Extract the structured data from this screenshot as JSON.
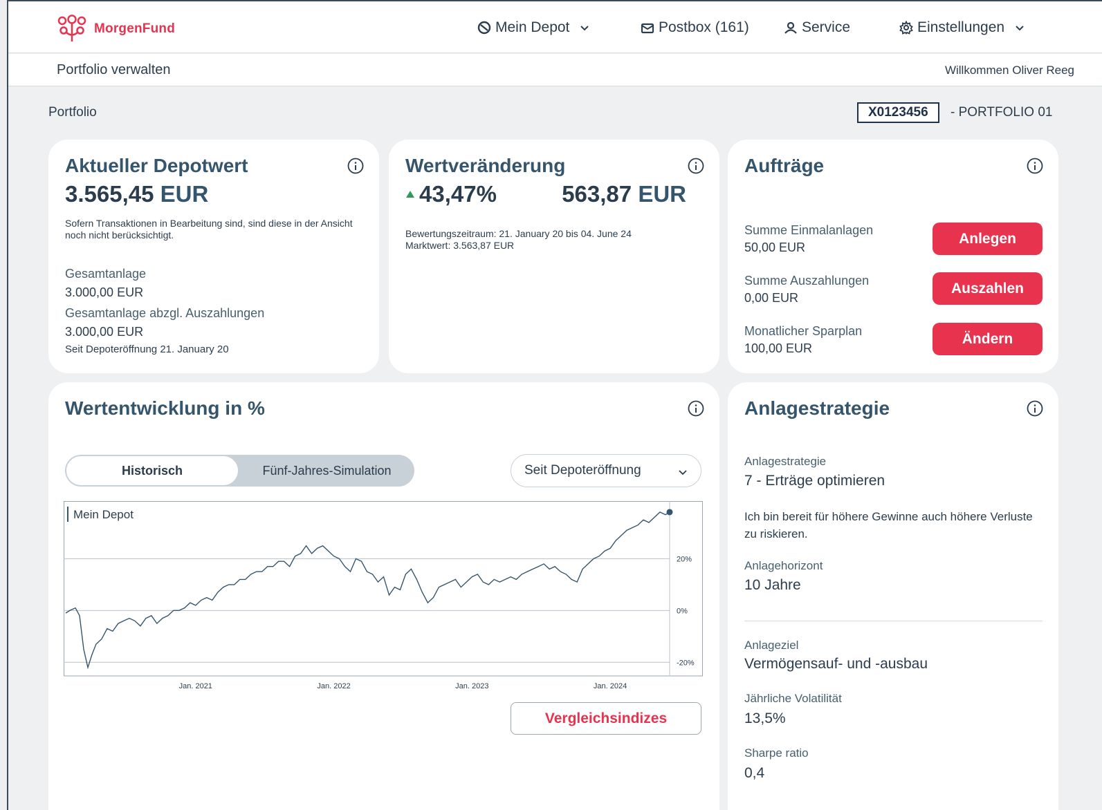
{
  "brand": {
    "name": "MorgenFund",
    "accent": "#e8334f",
    "primary_text": "#34556b"
  },
  "nav": {
    "mein_depot": "Mein Depot",
    "postbox": "Postbox (161)",
    "service": "Service",
    "einstellungen": "Einstellungen"
  },
  "subheader": {
    "title": "Portfolio verwalten",
    "welcome": "Willkommen Oliver Reeg"
  },
  "portfolio": {
    "label": "Portfolio",
    "id": "X0123456",
    "name": "- PORTFOLIO 01"
  },
  "depotwert": {
    "title": "Aktueller Depotwert",
    "amount": "3.565,45",
    "currency": "EUR",
    "note": "Sofern Transaktionen in Bearbeitung sind, sind diese in der Ansicht noch nicht berücksichtigt.",
    "gesamtanlage_label": "Gesamtanlage",
    "gesamtanlage_value": "3.000,00 EUR",
    "abzgl_label": "Gesamtanlage abzgl. Auszahlungen",
    "abzgl_value": "3.000,00 EUR",
    "seit": "Seit Depoteröffnung 21. January 20"
  },
  "wertveraenderung": {
    "title": "Wertveränderung",
    "percent": "43,47%",
    "amount": "563,87",
    "currency": "EUR",
    "zeitraum": "Bewertungszeitraum: 21. January 20 bis 04. June 24",
    "marktwert": "Marktwert: 3.563,87 EUR"
  },
  "auftraege": {
    "title": "Aufträge",
    "einmal_label": "Summe Einmalanlagen",
    "einmal_value": "50,00 EUR",
    "anlegen": "Anlegen",
    "ausz_label": "Summe Auszahlungen",
    "ausz_value": "0,00 EUR",
    "auszahlen": "Auszahlen",
    "spar_label": "Monatlicher Sparplan",
    "spar_value": "100,00 EUR",
    "aendern": "Ändern"
  },
  "wertentwicklung": {
    "title": "Wertentwicklung in %",
    "tab_historisch": "Historisch",
    "tab_simulation": "Fünf-Jahres-Simulation",
    "select_value": "Seit Depoteröffnung",
    "vergleich": "Vergleichsindizes"
  },
  "chart_data": {
    "type": "line",
    "legend": "Mein Depot",
    "ylim": [
      -25,
      42
    ],
    "yticks": [
      {
        "value": 20,
        "label": "20%"
      },
      {
        "value": 0,
        "label": "0%"
      },
      {
        "value": -20,
        "label": "-20%"
      }
    ],
    "xticks": [
      {
        "value": 2021.0,
        "label": "Jan. 2021"
      },
      {
        "value": 2022.0,
        "label": "Jan. 2022"
      },
      {
        "value": 2023.0,
        "label": "Jan. 2023"
      },
      {
        "value": 2024.0,
        "label": "Jan. 2024"
      }
    ],
    "xlim": [
      2020.05,
      2024.43
    ],
    "series": [
      {
        "name": "Mein Depot",
        "points": [
          [
            2020.06,
            -1
          ],
          [
            2020.09,
            0
          ],
          [
            2020.13,
            1
          ],
          [
            2020.16,
            -2
          ],
          [
            2020.19,
            -15
          ],
          [
            2020.22,
            -22
          ],
          [
            2020.25,
            -17
          ],
          [
            2020.28,
            -13
          ],
          [
            2020.32,
            -11
          ],
          [
            2020.36,
            -7
          ],
          [
            2020.4,
            -8
          ],
          [
            2020.44,
            -5
          ],
          [
            2020.48,
            -4
          ],
          [
            2020.52,
            -3
          ],
          [
            2020.56,
            -4
          ],
          [
            2020.6,
            -6
          ],
          [
            2020.64,
            -3
          ],
          [
            2020.68,
            -2
          ],
          [
            2020.72,
            -5
          ],
          [
            2020.76,
            -3
          ],
          [
            2020.8,
            -2
          ],
          [
            2020.84,
            0
          ],
          [
            2020.88,
            0
          ],
          [
            2020.92,
            1
          ],
          [
            2020.96,
            3
          ],
          [
            2021.0,
            2
          ],
          [
            2021.04,
            4
          ],
          [
            2021.08,
            5
          ],
          [
            2021.12,
            4
          ],
          [
            2021.16,
            7
          ],
          [
            2021.2,
            9
          ],
          [
            2021.24,
            10
          ],
          [
            2021.28,
            10
          ],
          [
            2021.32,
            12
          ],
          [
            2021.36,
            12
          ],
          [
            2021.4,
            14
          ],
          [
            2021.44,
            15
          ],
          [
            2021.48,
            15
          ],
          [
            2021.52,
            17
          ],
          [
            2021.56,
            17
          ],
          [
            2021.6,
            19
          ],
          [
            2021.64,
            19
          ],
          [
            2021.68,
            17
          ],
          [
            2021.72,
            21
          ],
          [
            2021.76,
            22
          ],
          [
            2021.8,
            25
          ],
          [
            2021.84,
            22
          ],
          [
            2021.88,
            24
          ],
          [
            2021.92,
            25
          ],
          [
            2021.96,
            23
          ],
          [
            2022.0,
            21
          ],
          [
            2022.04,
            20
          ],
          [
            2022.08,
            17
          ],
          [
            2022.12,
            15
          ],
          [
            2022.16,
            20
          ],
          [
            2022.2,
            19
          ],
          [
            2022.24,
            15
          ],
          [
            2022.28,
            14
          ],
          [
            2022.32,
            11
          ],
          [
            2022.36,
            13
          ],
          [
            2022.4,
            6
          ],
          [
            2022.44,
            9
          ],
          [
            2022.48,
            8
          ],
          [
            2022.52,
            14
          ],
          [
            2022.56,
            16
          ],
          [
            2022.6,
            12
          ],
          [
            2022.64,
            7
          ],
          [
            2022.68,
            3
          ],
          [
            2022.72,
            5
          ],
          [
            2022.76,
            9
          ],
          [
            2022.8,
            10
          ],
          [
            2022.84,
            11
          ],
          [
            2022.88,
            12
          ],
          [
            2022.92,
            9
          ],
          [
            2022.96,
            11
          ],
          [
            2023.0,
            13
          ],
          [
            2023.04,
            14
          ],
          [
            2023.08,
            11
          ],
          [
            2023.12,
            10
          ],
          [
            2023.16,
            12
          ],
          [
            2023.2,
            11
          ],
          [
            2023.24,
            12
          ],
          [
            2023.28,
            13
          ],
          [
            2023.32,
            12
          ],
          [
            2023.36,
            14
          ],
          [
            2023.4,
            15
          ],
          [
            2023.44,
            16
          ],
          [
            2023.48,
            17
          ],
          [
            2023.52,
            18
          ],
          [
            2023.56,
            16
          ],
          [
            2023.6,
            17
          ],
          [
            2023.64,
            15
          ],
          [
            2023.68,
            14
          ],
          [
            2023.72,
            12
          ],
          [
            2023.76,
            11
          ],
          [
            2023.8,
            16
          ],
          [
            2023.84,
            18
          ],
          [
            2023.88,
            20
          ],
          [
            2023.92,
            21
          ],
          [
            2023.96,
            23
          ],
          [
            2024.0,
            24
          ],
          [
            2024.04,
            27
          ],
          [
            2024.08,
            29
          ],
          [
            2024.12,
            31
          ],
          [
            2024.16,
            32
          ],
          [
            2024.2,
            33
          ],
          [
            2024.24,
            35
          ],
          [
            2024.28,
            34
          ],
          [
            2024.32,
            36
          ],
          [
            2024.36,
            38
          ],
          [
            2024.4,
            37
          ],
          [
            2024.43,
            38
          ]
        ]
      }
    ]
  },
  "anlagestrategie": {
    "title": "Anlagestrategie",
    "strategie_label": "Anlagestrategie",
    "strategie_value": "7 - Erträge optimieren",
    "beschreibung": "Ich bin bereit für höhere Gewinne auch höhere Verluste zu riskieren.",
    "horizont_label": "Anlagehorizont",
    "horizont_value": "10 Jahre",
    "ziel_label": "Anlageziel",
    "ziel_value": "Vermögensauf- und -ausbau",
    "vola_label": "Jährliche Volatilität",
    "vola_value": "13,5%",
    "sharpe_label": "Sharpe ratio",
    "sharpe_value": "0,4"
  }
}
